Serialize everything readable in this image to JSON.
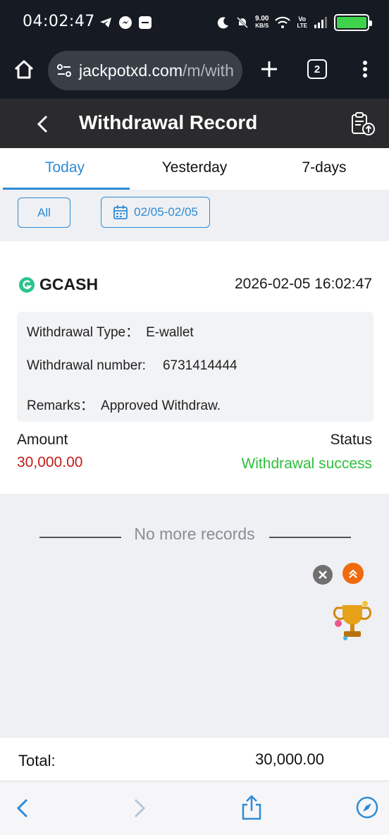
{
  "status_bar": {
    "time": "04:02:47",
    "network_speed_value": "9.00",
    "network_speed_unit": "KB/S",
    "volte_top": "Vo",
    "volte_bottom": "LTE"
  },
  "browser": {
    "url_host": "jackpotxd.com",
    "url_rest": "/m/with",
    "tab_count": "2"
  },
  "header": {
    "title": "Withdrawal Record"
  },
  "tabs": [
    {
      "label": "Today",
      "active": true
    },
    {
      "label": "Yesterday",
      "active": false
    },
    {
      "label": "7-days",
      "active": false
    }
  ],
  "filters": {
    "all_label": "All",
    "date_range": "02/05-02/05"
  },
  "record": {
    "method": "GCASH",
    "datetime": "2026-02-05 16:02:47",
    "type_label": "Withdrawal Type：",
    "type_value": "E-wallet",
    "number_label": "Withdrawal number:",
    "number_value": "6731414444",
    "remarks_label": "Remarks：",
    "remarks_value": "Approved Withdraw.",
    "amount_label": "Amount",
    "amount_value": "30,000.00",
    "status_label": "Status",
    "status_value": "Withdrawal success"
  },
  "list_end_text": "No more records",
  "footer": {
    "total_label": "Total:",
    "total_value": "30,000.00"
  },
  "colors": {
    "accent": "#2e8bd6",
    "amount": "#c31b1b",
    "success": "#2ebf3c",
    "header_bg": "#2b2b2d"
  }
}
